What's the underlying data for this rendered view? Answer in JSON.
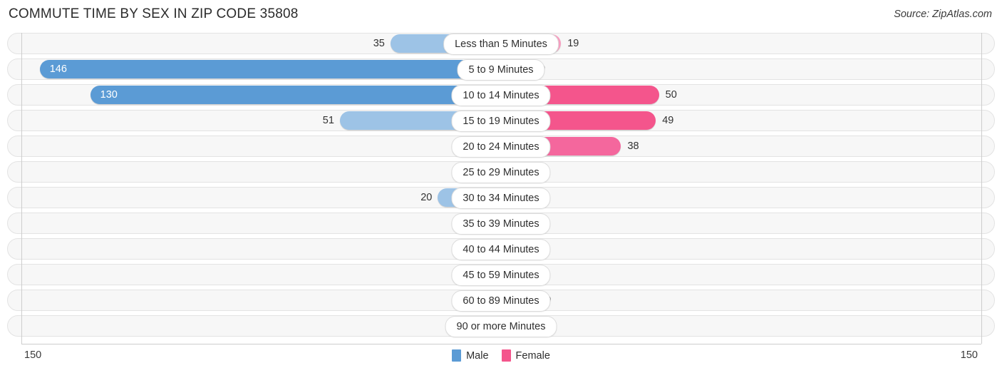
{
  "header": {
    "title": "COMMUTE TIME BY SEX IN ZIP CODE 35808",
    "source": "Source: ZipAtlas.com"
  },
  "legend": {
    "male_label": "Male",
    "female_label": "Female",
    "male_color": "#5b9bd5",
    "female_color": "#f4558c"
  },
  "axis": {
    "left_end": "150",
    "right_end": "150",
    "max": 150
  },
  "colors": {
    "male_light": "#9dc3e6",
    "male_dark": "#5b9bd5",
    "female_light": "#f79ec0",
    "female_mid": "#f4679d",
    "female_dark": "#f4558c",
    "track_fill": "#f7f7f7",
    "track_border": "#e3e3e3"
  },
  "chart_data": {
    "type": "bar",
    "title": "COMMUTE TIME BY SEX IN ZIP CODE 35808",
    "xlabel": "",
    "ylabel": "",
    "orientation": "horizontal-diverging",
    "xlim": [
      0,
      150
    ],
    "grid": false,
    "legend_position": "bottom-center",
    "categories": [
      "Less than 5 Minutes",
      "5 to 9 Minutes",
      "10 to 14 Minutes",
      "15 to 19 Minutes",
      "20 to 24 Minutes",
      "25 to 29 Minutes",
      "30 to 34 Minutes",
      "35 to 39 Minutes",
      "40 to 44 Minutes",
      "45 to 59 Minutes",
      "60 to 89 Minutes",
      "90 or more Minutes"
    ],
    "series": [
      {
        "name": "Male",
        "values": [
          35,
          146,
          130,
          51,
          7,
          5,
          20,
          0,
          0,
          0,
          0,
          0
        ]
      },
      {
        "name": "Female",
        "values": [
          19,
          0,
          50,
          49,
          38,
          4,
          5,
          6,
          0,
          0,
          10,
          0
        ]
      }
    ]
  },
  "rows": [
    {
      "label": "Less than 5 Minutes",
      "male": "35",
      "female": "19"
    },
    {
      "label": "5 to 9 Minutes",
      "male": "146",
      "female": "0"
    },
    {
      "label": "10 to 14 Minutes",
      "male": "130",
      "female": "50"
    },
    {
      "label": "15 to 19 Minutes",
      "male": "51",
      "female": "49"
    },
    {
      "label": "20 to 24 Minutes",
      "male": "7",
      "female": "38"
    },
    {
      "label": "25 to 29 Minutes",
      "male": "5",
      "female": "4"
    },
    {
      "label": "30 to 34 Minutes",
      "male": "20",
      "female": "5"
    },
    {
      "label": "35 to 39 Minutes",
      "male": "0",
      "female": "6"
    },
    {
      "label": "40 to 44 Minutes",
      "male": "0",
      "female": "0"
    },
    {
      "label": "45 to 59 Minutes",
      "male": "0",
      "female": "0"
    },
    {
      "label": "60 to 89 Minutes",
      "male": "0",
      "female": "10"
    },
    {
      "label": "90 or more Minutes",
      "male": "0",
      "female": "0"
    }
  ]
}
